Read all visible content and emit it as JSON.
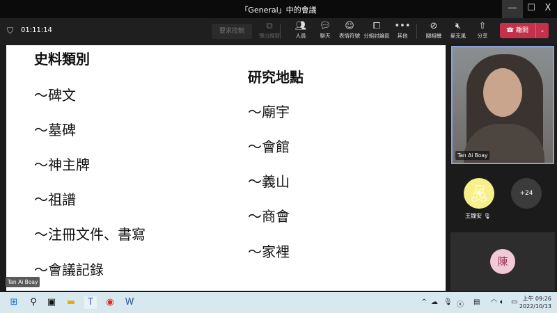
{
  "window": {
    "title": "「General」中的會議",
    "minimize": "—",
    "maximize": "☐",
    "close": "X"
  },
  "toolbar": {
    "timer": "01:11:14",
    "request_control": "要求控制",
    "buttons": [
      {
        "label": "彈出視窗",
        "icon": "popout-icon"
      },
      {
        "label": "人員",
        "icon": "people-icon"
      },
      {
        "label": "聊天",
        "icon": "chat-icon"
      },
      {
        "label": "表情符號",
        "icon": "reactions-icon"
      },
      {
        "label": "分組討論區",
        "icon": "breakout-rooms-icon"
      },
      {
        "label": "其他",
        "icon": "more-icon"
      },
      {
        "label": "關相機",
        "icon": "camera-off-icon"
      },
      {
        "label": "麥克風",
        "icon": "mic-off-icon"
      },
      {
        "label": "分享",
        "icon": "share-icon"
      }
    ],
    "leave": "離開"
  },
  "shared_content": {
    "left_heading": "史料類別",
    "left_items": [
      "～碑文",
      "～墓碑",
      "～神主牌",
      "～祖譜",
      "～注冊文件、書寫",
      "～會議記錄"
    ],
    "right_heading": "研究地點",
    "right_items": [
      "～廟宇",
      "～會館",
      "～義山",
      "～商會",
      "～家裡"
    ],
    "presenter": "Tan Ai Boay"
  },
  "participants": {
    "video_name": "Tan Ai Boay",
    "p2_name": "王鐘安",
    "overflow": "+24",
    "initial": "陳"
  },
  "taskbar": {
    "time": "上午 09:26",
    "date": "2022/10/13"
  }
}
